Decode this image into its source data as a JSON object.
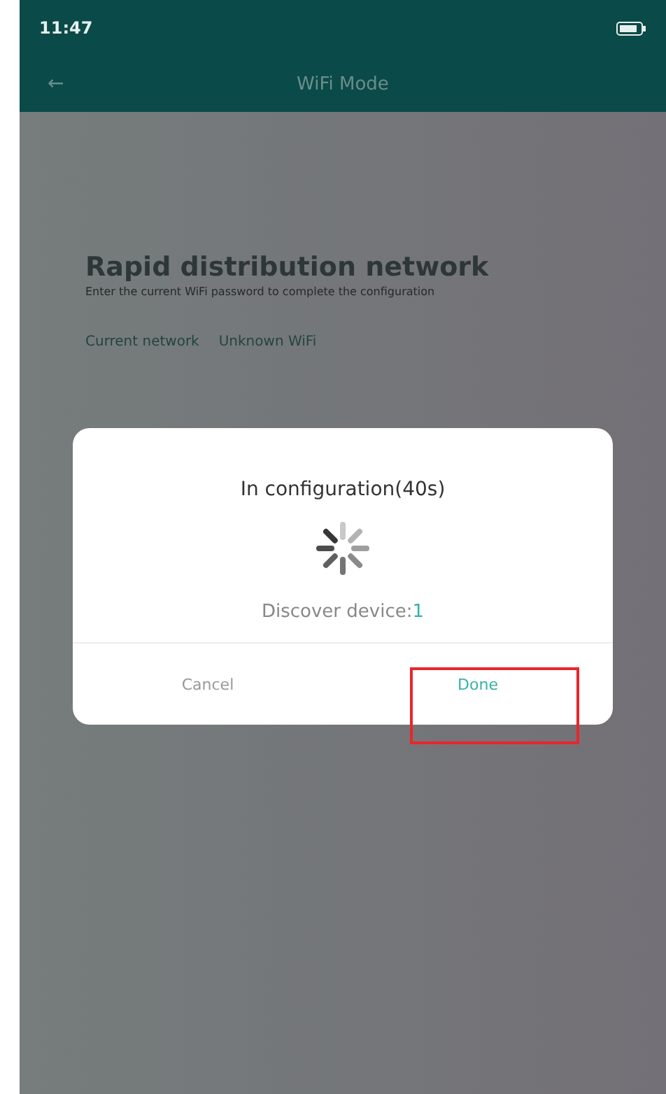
{
  "status_bar": {
    "time": "11:47"
  },
  "header": {
    "back": "←",
    "title": "WiFi Mode"
  },
  "page": {
    "title": "Rapid distribution network",
    "subtitle": "Enter the current WiFi password to complete the configuration",
    "network_label": "Current network",
    "network_value": "Unknown WiFi"
  },
  "dialog": {
    "title": "In configuration(40s)",
    "discover_label": "Discover device:",
    "discover_count": "1",
    "buttons": [
      {
        "label": "Cancel",
        "kind": "secondary",
        "highlighted": false
      },
      {
        "label": "Done",
        "kind": "primary",
        "highlighted": true
      }
    ]
  }
}
